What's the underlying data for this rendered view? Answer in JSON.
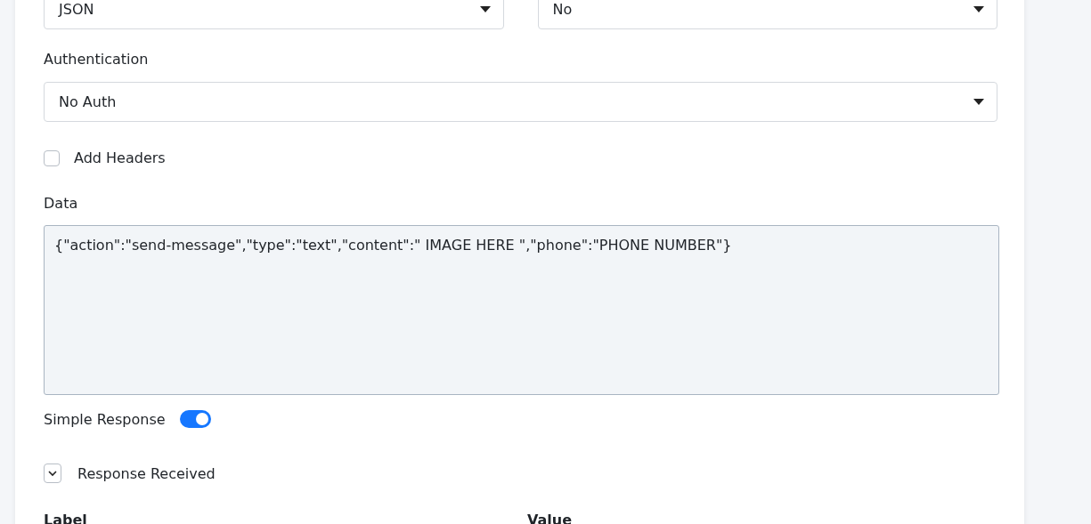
{
  "top_selects": [
    {
      "value": "JSON"
    },
    {
      "value": "No"
    }
  ],
  "authentication": {
    "label": "Authentication",
    "value": "No Auth"
  },
  "add_headers": {
    "label": "Add Headers",
    "checked": false
  },
  "data": {
    "label": "Data",
    "value": "{\"action\":\"send-message\",\"type\":\"text\",\"content\":\" IMAGE HERE \",\"phone\":\"PHONE NUMBER\"}"
  },
  "simple_response": {
    "label": "Simple Response",
    "on": true
  },
  "response_received": {
    "label": "Response Received",
    "expanded": true
  },
  "columns": [
    "Label",
    "Value"
  ]
}
